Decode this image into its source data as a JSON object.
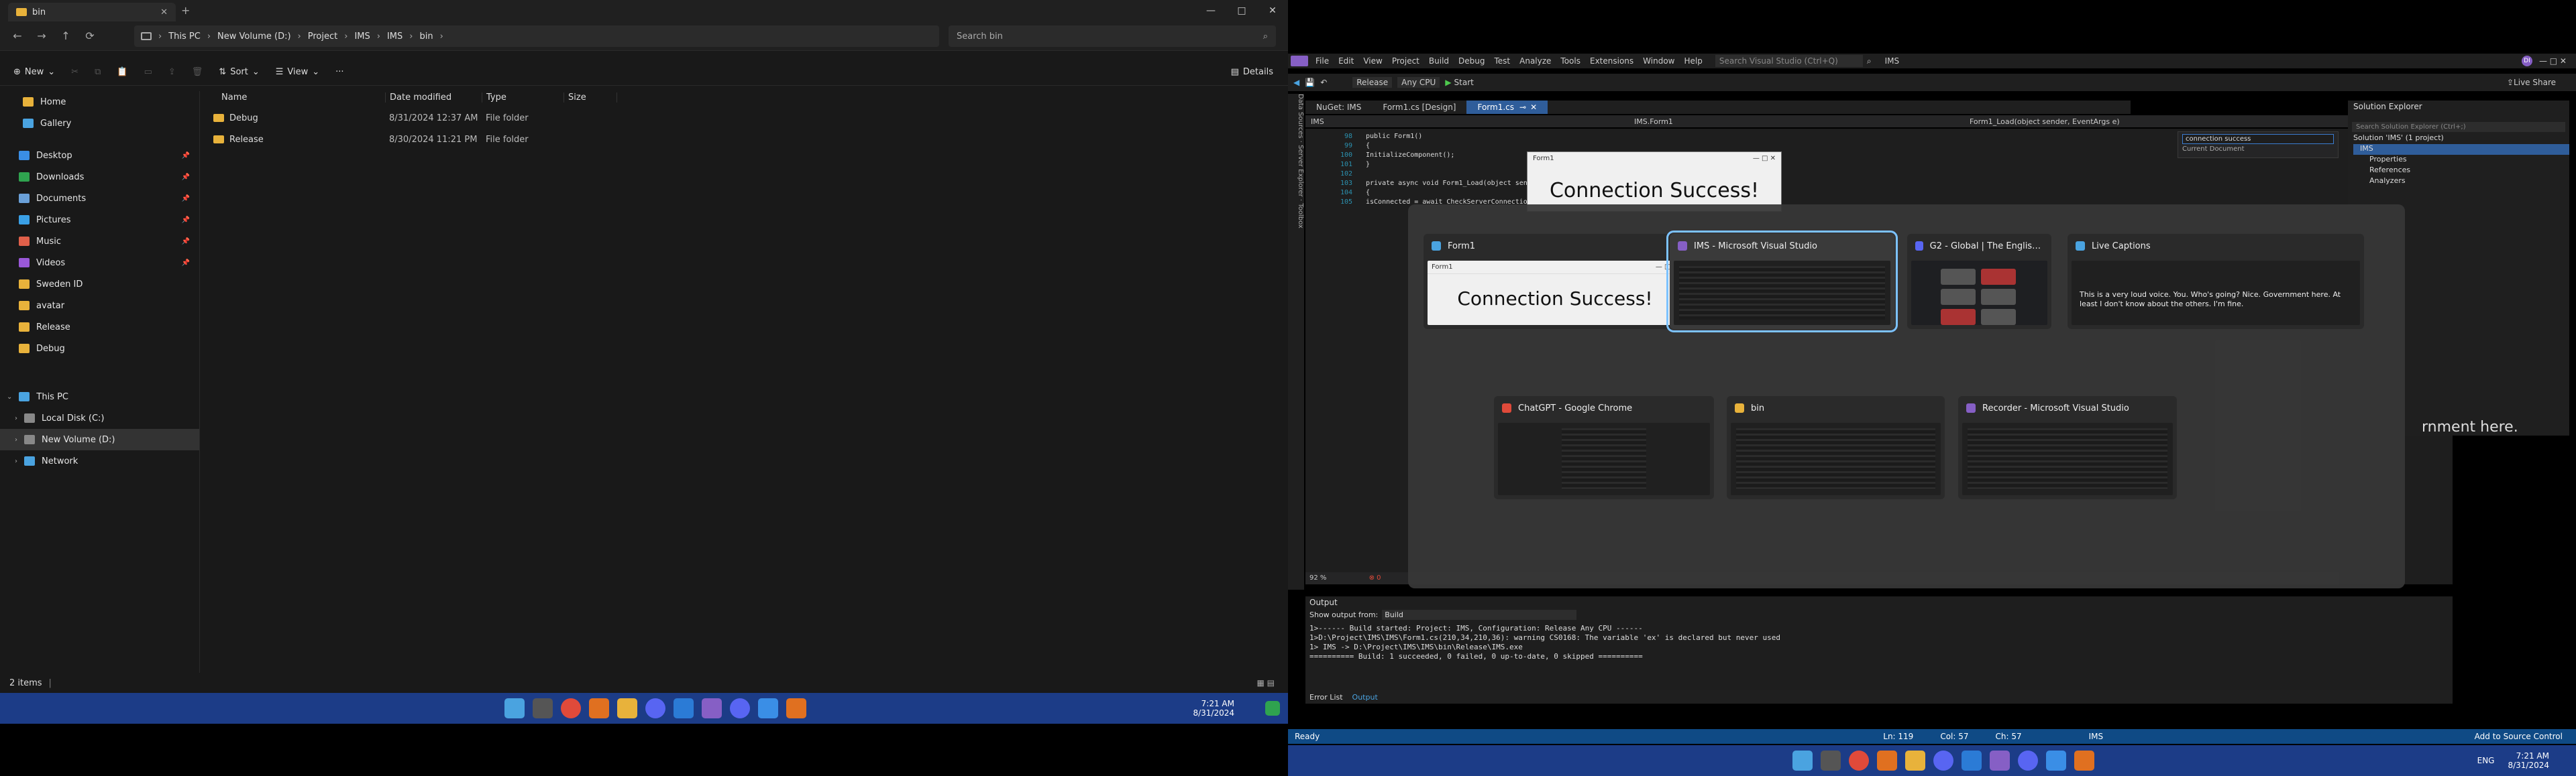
{
  "explorer": {
    "tab_title": "bin",
    "window_controls": [
      "—",
      "□",
      "✕"
    ],
    "nav": {
      "back": "←",
      "forward": "→",
      "up": "↑",
      "refresh": "⟳"
    },
    "breadcrumb": [
      "This PC",
      "New Volume (D:)",
      "Project",
      "IMS",
      "IMS",
      "bin"
    ],
    "search_placeholder": "Search bin",
    "cmd": {
      "new": "New",
      "sort": "Sort",
      "view": "View",
      "more": "···",
      "details": "Details"
    },
    "sidebar": {
      "quick": [
        {
          "label": "Home",
          "color": "#e8b23b",
          "pin": false
        },
        {
          "label": "Gallery",
          "color": "#4aa3e0",
          "pin": false
        },
        {
          "label": "Desktop",
          "color": "#3a8ee6",
          "pin": true
        },
        {
          "label": "Downloads",
          "color": "#2fa34f",
          "pin": true
        },
        {
          "label": "Documents",
          "color": "#6aa0d8",
          "pin": true
        },
        {
          "label": "Pictures",
          "color": "#3aa0e6",
          "pin": true
        },
        {
          "label": "Music",
          "color": "#e0604a",
          "pin": true
        },
        {
          "label": "Videos",
          "color": "#9a58d8",
          "pin": true
        },
        {
          "label": "Sweden ID",
          "color": "#e8b23b",
          "pin": false
        },
        {
          "label": "avatar",
          "color": "#e8b23b",
          "pin": false
        },
        {
          "label": "Release",
          "color": "#e8b23b",
          "pin": false
        },
        {
          "label": "Debug",
          "color": "#e8b23b",
          "pin": false
        }
      ],
      "tree": [
        {
          "label": "This PC",
          "expanded": true
        },
        {
          "label": "Local Disk (C:)",
          "expanded": false
        },
        {
          "label": "New Volume (D:)",
          "expanded": false,
          "selected": true
        },
        {
          "label": "Network",
          "expanded": false
        }
      ]
    },
    "columns": [
      "Name",
      "Date modified",
      "Type",
      "Size"
    ],
    "rows": [
      {
        "name": "Debug",
        "date": "8/31/2024 12:37 AM",
        "type": "File folder",
        "size": ""
      },
      {
        "name": "Release",
        "date": "8/30/2024 11:21 PM",
        "type": "File folder",
        "size": ""
      }
    ],
    "status": "2 items",
    "clock": {
      "time": "7:21 AM",
      "date": "8/31/2024"
    }
  },
  "vs": {
    "menu": [
      "File",
      "Edit",
      "View",
      "Project",
      "Build",
      "Debug",
      "Test",
      "Analyze",
      "Tools",
      "Extensions",
      "Window",
      "Help"
    ],
    "search_placeholder": "Search Visual Studio (Ctrl+Q)",
    "solution_name": "IMS",
    "toolbar": {
      "config": "Release",
      "platform": "Any CPU",
      "start": "Start",
      "live_share": "Live Share"
    },
    "tabs": [
      "NuGet: IMS",
      "Form1.cs [Design]",
      "Form1.cs"
    ],
    "nav_dropdowns": [
      "IMS",
      "IMS.Form1",
      "Form1_Load(object sender, EventArgs e)"
    ],
    "find_text": "connection success",
    "find_scope": "Current Document",
    "code": [
      {
        "n": "98",
        "t": "    public Form1()"
      },
      {
        "n": "99",
        "t": "    {"
      },
      {
        "n": "100",
        "t": "        InitializeComponent();"
      },
      {
        "n": "101",
        "t": "    }"
      },
      {
        "n": "102",
        "t": ""
      },
      {
        "n": "103",
        "t": "    private async void Form1_Load(object sender, EventArgs e)"
      },
      {
        "n": "104",
        "t": "    {"
      },
      {
        "n": "105",
        "t": "        isConnected = await CheckServerConnection(connection);"
      }
    ],
    "zoom": "92 %",
    "output": {
      "title": "Output",
      "show_from_label": "Show output from:",
      "show_from_value": "Build",
      "lines": [
        "1>------ Build started: Project: IMS, Configuration: Release Any CPU ------",
        "1>D:\\Project\\IMS\\IMS\\Form1.cs(210,34,210,36): warning CS0168: The variable 'ex' is declared but never used",
        "1>  IMS -> D:\\Project\\IMS\\IMS\\bin\\Release\\IMS.exe",
        "========== Build: 1 succeeded, 0 failed, 0 up-to-date, 0 skipped =========="
      ],
      "tabs": [
        "Error List",
        "Output"
      ]
    },
    "solution_explorer": {
      "title": "Solution Explorer",
      "search_placeholder": "Search Solution Explorer (Ctrl+;)",
      "items": [
        "Solution 'IMS' (1 project)",
        "IMS",
        "Properties",
        "References",
        "Analyzers"
      ]
    },
    "status": {
      "ready": "Ready",
      "ln": "Ln: 119",
      "col": "Col: 57",
      "ch": "Ch: 57",
      "project": "IMS",
      "source_control": "Add to Source Control"
    },
    "bg_form_title": "Form1",
    "bg_form_text": "Connection Success!",
    "live_caption_partial": "rnment here.",
    "clock": {
      "time": "7:21 AM",
      "date": "8/31/2024"
    },
    "lang": "ENG"
  },
  "alttab": {
    "cards": [
      {
        "title": "Form1",
        "kind": "form",
        "selected": false,
        "inner_title": "Form1",
        "inner_text": "Connection Success!"
      },
      {
        "title": "IMS - Microsoft Visual Studio",
        "kind": "vs",
        "selected": true
      },
      {
        "title": "G2 - Global | The English Hub...",
        "kind": "discord",
        "selected": false
      },
      {
        "title": "Live Captions",
        "kind": "captions",
        "selected": false,
        "text": "This is a very loud voice. You. Who's going? Nice. Government here. At least I don't know about the others. I'm fine."
      },
      {
        "title": "ChatGPT - Google Chrome",
        "kind": "chrome",
        "selected": false
      },
      {
        "title": "bin",
        "kind": "explorer",
        "selected": false
      },
      {
        "title": "Recorder - Microsoft Visual Studio",
        "kind": "vs",
        "selected": false
      }
    ]
  },
  "colors": {
    "explorer_bg": "#191919",
    "taskbar": "#1c3c87",
    "vs_status": "#0f4a85",
    "selection": "#7cc2ff",
    "folder": "#e8b23b"
  }
}
